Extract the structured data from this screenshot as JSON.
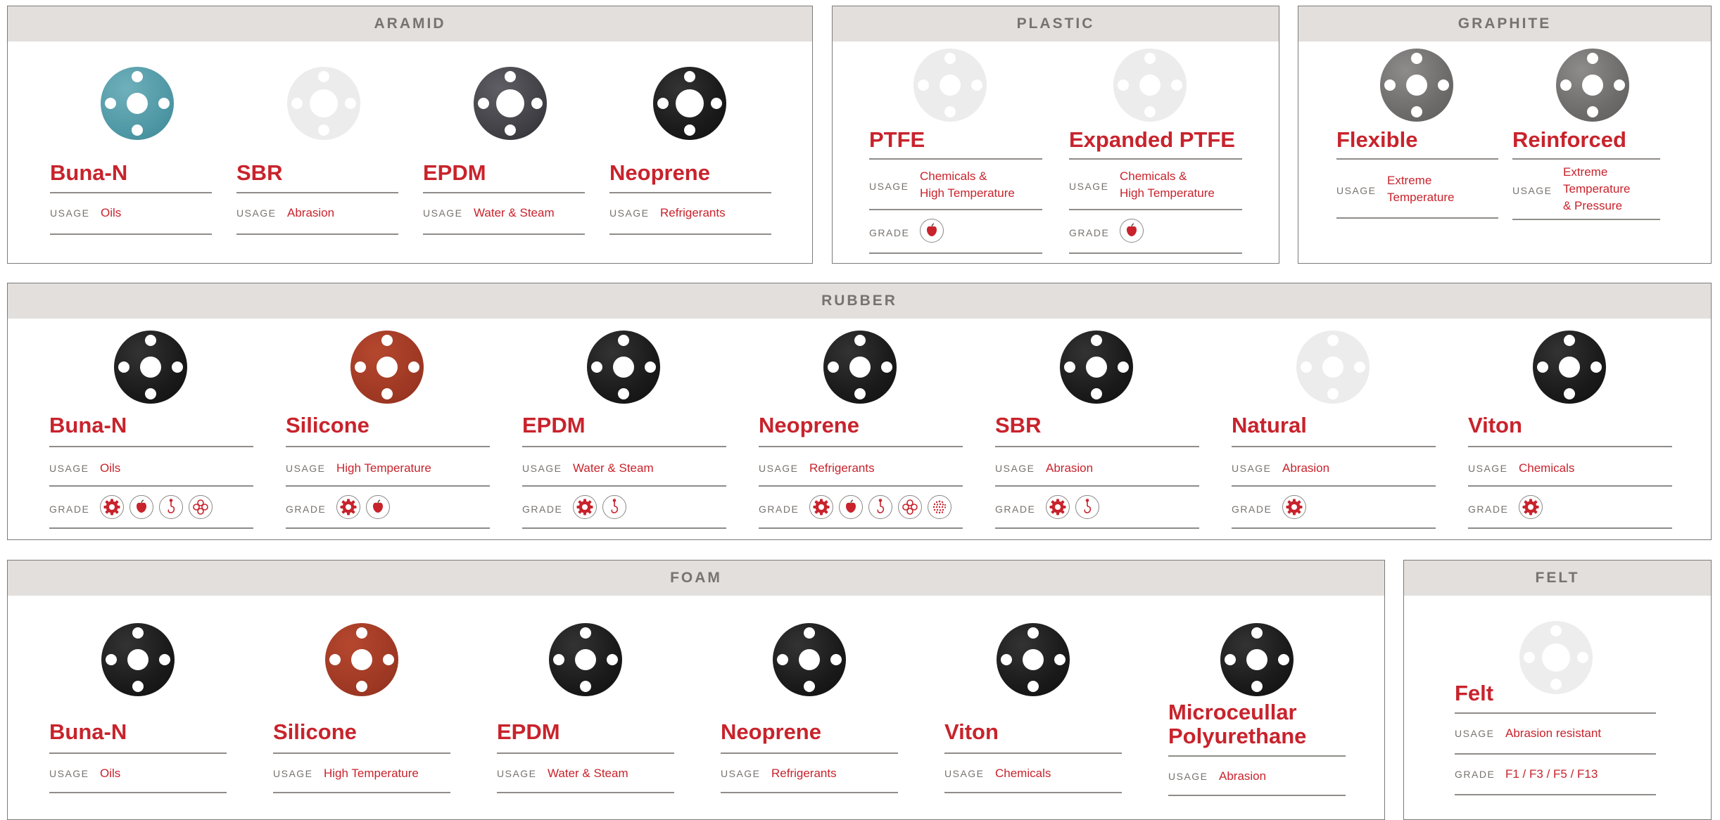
{
  "panels": {
    "aramid": {
      "title": "ARAMID",
      "items": [
        {
          "name": "Buna-N",
          "usage": "Oils"
        },
        {
          "name": "SBR",
          "usage": "Abrasion"
        },
        {
          "name": "EPDM",
          "usage": "Water & Steam"
        },
        {
          "name": "Neoprene",
          "usage": "Refrigerants"
        }
      ]
    },
    "plastic": {
      "title": "PLASTIC",
      "items": [
        {
          "name": "PTFE",
          "usage": [
            "Chemicals &",
            "High Temperature"
          ],
          "grade": [
            "apple-icon"
          ]
        },
        {
          "name": "Expanded PTFE",
          "usage": [
            "Chemicals &",
            "High Temperature"
          ],
          "grade": [
            "apple-icon"
          ]
        }
      ]
    },
    "graphite": {
      "title": "GRAPHITE",
      "items": [
        {
          "name": "Flexible",
          "usage": [
            "Extreme",
            "Temperature"
          ]
        },
        {
          "name": "Reinforced",
          "usage": [
            "Extreme",
            "Temperature",
            "& Pressure"
          ]
        }
      ]
    },
    "rubber": {
      "title": "RUBBER",
      "items": [
        {
          "name": "Buna-N",
          "usage": "Oils",
          "grade": [
            "gear-icon",
            "apple-icon",
            "hook-icon",
            "knot-icon"
          ]
        },
        {
          "name": "Silicone",
          "usage": "High Temperature",
          "grade": [
            "gear-icon",
            "apple-icon"
          ]
        },
        {
          "name": "EPDM",
          "usage": "Water & Steam",
          "grade": [
            "gear-icon",
            "hook-icon"
          ]
        },
        {
          "name": "Neoprene",
          "usage": "Refrigerants",
          "grade": [
            "gear-icon",
            "apple-icon",
            "hook-icon",
            "knot-icon",
            "dots-icon"
          ]
        },
        {
          "name": "SBR",
          "usage": "Abrasion",
          "grade": [
            "gear-icon",
            "hook-icon"
          ]
        },
        {
          "name": "Natural",
          "usage": "Abrasion",
          "grade": [
            "gear-icon"
          ]
        },
        {
          "name": "Viton",
          "usage": "Chemicals",
          "grade": [
            "gear-icon"
          ]
        }
      ]
    },
    "foam": {
      "title": "FOAM",
      "items": [
        {
          "name": "Buna-N",
          "usage": "Oils"
        },
        {
          "name": "Silicone",
          "usage": "High Temperature"
        },
        {
          "name": "EPDM",
          "usage": "Water & Steam"
        },
        {
          "name": "Neoprene",
          "usage": "Refrigerants"
        },
        {
          "name": "Viton",
          "usage": "Chemicals"
        },
        {
          "name": [
            "Microceullar",
            "Polyurethane"
          ],
          "usage": "Abrasion"
        }
      ]
    },
    "felt": {
      "title": "FELT",
      "items": [
        {
          "name": "Felt",
          "usage": "Abrasion resistant",
          "grade_text": "F1 / F3 / F5 / F13"
        }
      ]
    }
  },
  "labels": {
    "usage": "USAGE",
    "grade": "GRADE"
  },
  "colors": {
    "accent": "#c8232c",
    "header_bg": "#e2dfdc",
    "header_text": "#77736f",
    "border": "#7d7b78"
  }
}
